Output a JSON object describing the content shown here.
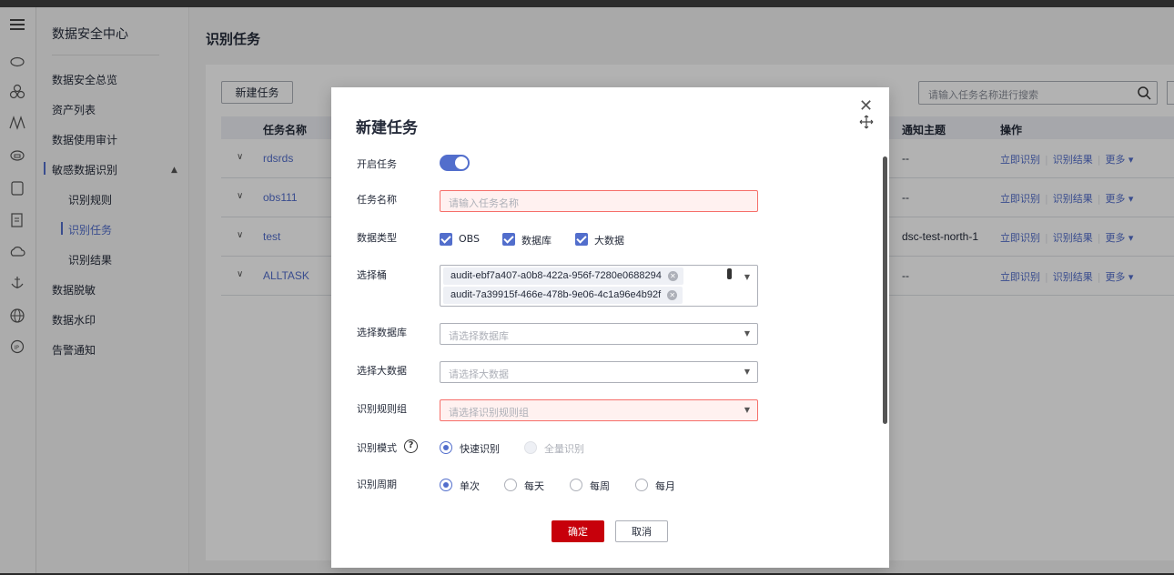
{
  "sidebar": {
    "title": "数据安全中心",
    "items": [
      {
        "label": "数据安全总览"
      },
      {
        "label": "资产列表"
      },
      {
        "label": "数据使用审计"
      },
      {
        "label": "敏感数据识别"
      },
      {
        "label": "识别规则"
      },
      {
        "label": "识别任务"
      },
      {
        "label": "识别结果"
      },
      {
        "label": "数据脱敏"
      },
      {
        "label": "数据水印"
      },
      {
        "label": "告警通知"
      }
    ]
  },
  "page": {
    "title": "识别任务",
    "new_button": "新建任务",
    "search_placeholder": "请输入任务名称进行搜索"
  },
  "table": {
    "headers": {
      "name": "任务名称",
      "notify": "通知主题",
      "ops": "操作"
    },
    "rows": [
      {
        "name": "rdsrds",
        "notify": "--"
      },
      {
        "name": "obs111",
        "notify": "--"
      },
      {
        "name": "test",
        "notify": "dsc-test-north-1"
      },
      {
        "name": "ALLTASK",
        "notify": "--"
      }
    ],
    "ops": {
      "run": "立即识别",
      "result": "识别结果",
      "more": "更多 ▾"
    }
  },
  "modal": {
    "title": "新建任务",
    "enable_label": "开启任务",
    "enabled": true,
    "name_label": "任务名称",
    "name_placeholder": "请输入任务名称",
    "datatype_label": "数据类型",
    "datatypes": [
      {
        "label": "OBS",
        "checked": true
      },
      {
        "label": "数据库",
        "checked": true
      },
      {
        "label": "大数据",
        "checked": true
      }
    ],
    "bucket_label": "选择桶",
    "buckets": [
      "audit-ebf7a407-a0b8-422a-956f-7280e0688294",
      "audit-7a39915f-466e-478b-9e06-4c1a96e4b92f"
    ],
    "db_label": "选择数据库",
    "db_placeholder": "请选择数据库",
    "bigdata_label": "选择大数据",
    "bigdata_placeholder": "请选择大数据",
    "rulegroup_label": "识别规则组",
    "rulegroup_placeholder": "请选择识别规则组",
    "mode_label": "识别模式",
    "modes": [
      {
        "label": "快速识别",
        "selected": true
      },
      {
        "label": "全量识别",
        "selected": false,
        "disabled": true
      }
    ],
    "period_label": "识别周期",
    "periods": [
      {
        "label": "单次",
        "selected": true
      },
      {
        "label": "每天",
        "selected": false
      },
      {
        "label": "每周",
        "selected": false
      },
      {
        "label": "每月",
        "selected": false
      }
    ],
    "ok": "确定",
    "cancel": "取消"
  },
  "colors": {
    "accent": "#526ecc",
    "primary_button": "#c7000b",
    "error_bg": "#fff1f0"
  }
}
